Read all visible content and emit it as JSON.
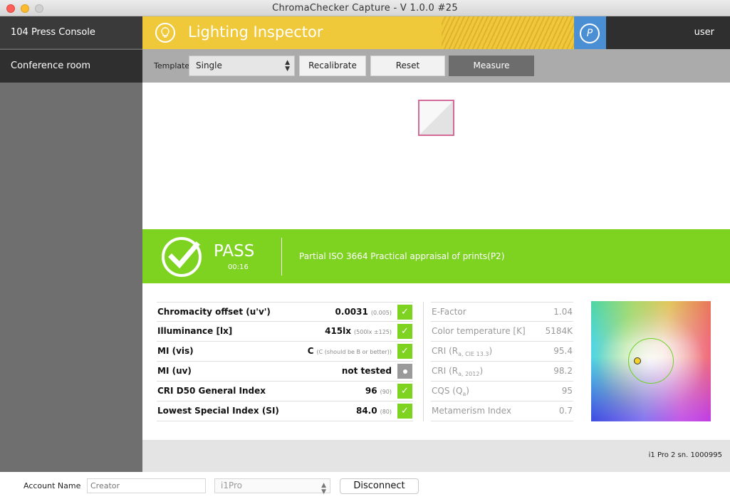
{
  "window": {
    "title": "ChromaChecker Capture  -  V 1.0.0 #25"
  },
  "sidebar": {
    "items": [
      {
        "label": "104 Press Console"
      },
      {
        "label": "Conference room"
      }
    ]
  },
  "header": {
    "title": "Lighting Inspector",
    "user": "user",
    "icons": [
      "lightbulb-icon",
      "p-logo-icon"
    ],
    "colors": {
      "yellow": "#f0c93b",
      "blue": "#4a8fd4",
      "dark": "#2f2f2f"
    }
  },
  "toolbar": {
    "template_label": "Template",
    "template_value": "Single",
    "recalibrate_label": "Recalibrate",
    "reset_label": "Reset",
    "measure_label": "Measure"
  },
  "result": {
    "status": "PASS",
    "time": "00:16",
    "description": "Partial ISO 3664 Practical appraisal of prints(P2)",
    "color": "#7ed321"
  },
  "metrics": [
    {
      "name": "Chromacity offset (u'v')",
      "value": "0.0031",
      "hint": "(0.005)",
      "status": "pass"
    },
    {
      "name": "Illuminance [lx]",
      "value": "415lx",
      "hint": "(500lx ±125)",
      "status": "pass"
    },
    {
      "name": "MI (vis)",
      "value": "C",
      "hint": "(C (should be B or better))",
      "status": "pass"
    },
    {
      "name": "MI (uv)",
      "value": "not tested",
      "hint": "",
      "status": "not-tested"
    },
    {
      "name": "CRI D50 General Index",
      "value": "96",
      "hint": "(90)",
      "status": "pass"
    },
    {
      "name": "Lowest Special Index (SI)",
      "value": "84.0",
      "hint": "(80)",
      "status": "pass"
    }
  ],
  "details": [
    {
      "name": "E-Factor",
      "sub": "",
      "value": "1.04"
    },
    {
      "name": "Color temperature [K]",
      "sub": "",
      "value": "5184K"
    },
    {
      "name": "CRI (R",
      "sub": "a, CIE 13.3",
      "suffix": ")",
      "value": "95.4"
    },
    {
      "name": "CRI (R",
      "sub": "a, 2012",
      "suffix": ")",
      "value": "98.2"
    },
    {
      "name": "CQS (Q",
      "sub": "a",
      "suffix": ")",
      "value": "95"
    },
    {
      "name": "Metamerism Index",
      "sub": "",
      "value": "0.7"
    }
  ],
  "device": {
    "serial": "i1 Pro 2 sn. 1000995"
  },
  "footer": {
    "account_label": "Account Name",
    "account_placeholder": "Creator",
    "device_value": "i1Pro",
    "disconnect_label": "Disconnect"
  }
}
